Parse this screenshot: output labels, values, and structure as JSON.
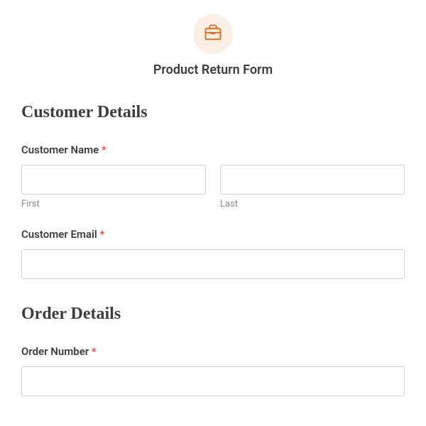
{
  "header": {
    "title": "Product Return Form",
    "icon": "briefcase-icon",
    "icon_color": "#e06a1a",
    "icon_bg": "#faeee5"
  },
  "sections": {
    "customer": {
      "heading": "Customer Details",
      "name": {
        "label": "Customer Name",
        "required": "*",
        "first": {
          "value": "",
          "sublabel": "First"
        },
        "last": {
          "value": "",
          "sublabel": "Last"
        }
      },
      "email": {
        "label": "Customer Email",
        "required": "*",
        "value": ""
      }
    },
    "order": {
      "heading": "Order Details",
      "order_number": {
        "label": "Order Number",
        "required": "*",
        "value": ""
      }
    }
  }
}
